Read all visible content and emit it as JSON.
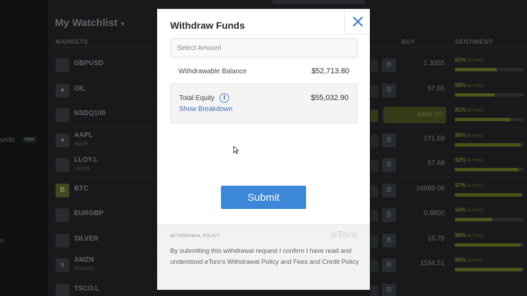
{
  "sidebar": {
    "items": [
      {
        "label": "unds",
        "badge": "NEW"
      },
      {
        "label": "s"
      }
    ]
  },
  "watchlist": {
    "title": "My Watchlist",
    "columns": {
      "markets": "MARKETS",
      "buy": "BUY",
      "sentiment": "SENTIMENT"
    },
    "rows": [
      {
        "symbol": "GBPUSD",
        "sub": "",
        "logo": "flag",
        "price": "1.3355",
        "pct": "61%",
        "buying": "BUYING",
        "fill": 0.61
      },
      {
        "symbol": "OIL",
        "sub": "",
        "logo": "drop",
        "price": "57.65",
        "pct": "58%",
        "buying": "BUYING",
        "fill": 0.58
      },
      {
        "symbol": "NSDQ100",
        "sub": "",
        "logo": "flag",
        "price": "6989.00",
        "pct": "81%",
        "buying": "BUYING",
        "fill": 0.81,
        "highlight": true
      },
      {
        "symbol": "AAPL",
        "sub": "Apple",
        "logo": "apple",
        "price": "171.69",
        "pct": "96%",
        "buying": "BUYING",
        "fill": 0.96
      },
      {
        "symbol": "LLOY.L",
        "sub": "Lloyds",
        "logo": "horse",
        "price": "67.68",
        "pct": "92%",
        "buying": "BUYING",
        "fill": 0.92
      },
      {
        "symbol": "BTC",
        "sub": "",
        "logo": "B",
        "price": "16985.08",
        "pct": "97%",
        "buying": "BUYING",
        "fill": 0.97
      },
      {
        "symbol": "EURGBP",
        "sub": "",
        "logo": "flag",
        "price": "0.8800",
        "pct": "54%",
        "buying": "BUYING",
        "fill": 0.54
      },
      {
        "symbol": "SILVER",
        "sub": "",
        "logo": "bar",
        "price": "15.75",
        "pct": "96%",
        "buying": "BUYING",
        "fill": 0.96
      },
      {
        "symbol": "AMZN",
        "sub": "Amazon",
        "logo": "a",
        "price": "1164.51",
        "pct": "98%",
        "buying": "BUYING",
        "fill": 0.98
      },
      {
        "symbol": "TSCO.L",
        "sub": "",
        "logo": "t",
        "price": "",
        "pct": "",
        "buying": "",
        "fill": 0
      }
    ]
  },
  "modal": {
    "title": "Withdraw Funds",
    "close_icon": "close-icon",
    "amount": {
      "placeholder": "Select Amount",
      "value": ""
    },
    "withdrawable": {
      "label": "Withdrawable Balance",
      "value": "$52,713.80"
    },
    "equity": {
      "label": "Total Equity",
      "value": "$55,032.90",
      "breakdown_link": "Show Breakdown"
    },
    "submit_label": "Submit",
    "policy": {
      "title": "WITHDRAWAL POLICY",
      "logo_text": "eToro",
      "text_prefix": "By submitting this withdrawal request I confirm I have read and understood eToro's ",
      "link1": "Withdrawal Policy",
      "and": " and ",
      "link2": "Fees and Credit Policy"
    }
  },
  "colors": {
    "accent": "#3d87d8",
    "sentiment": "#6e7c25",
    "link": "#3a6ab0"
  }
}
